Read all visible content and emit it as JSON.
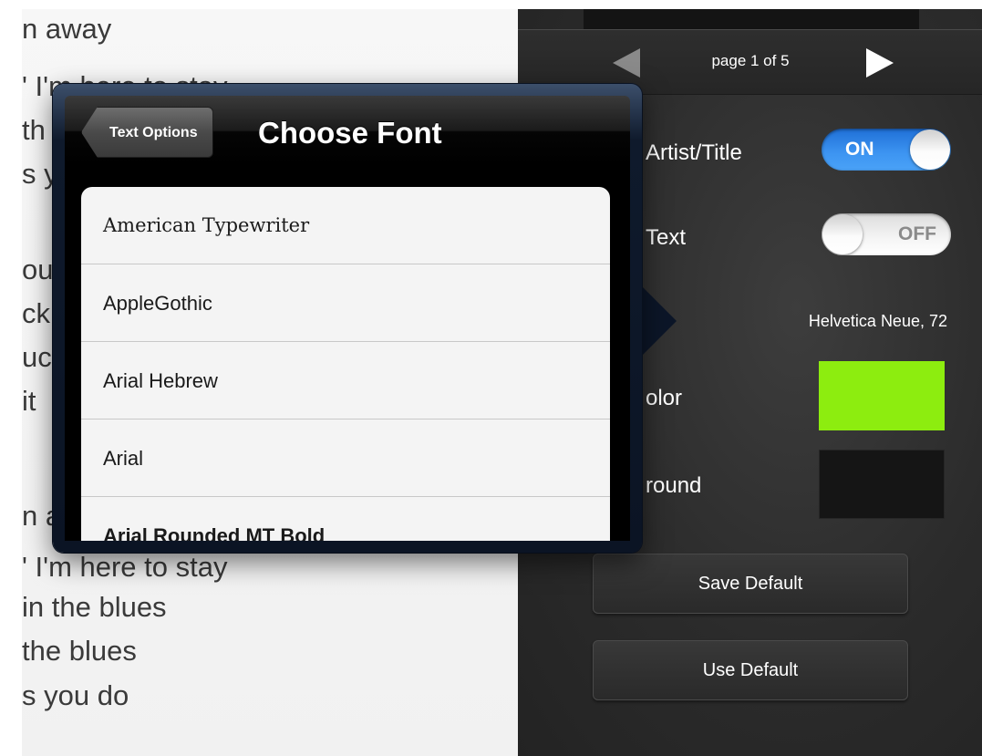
{
  "lyrics": {
    "lines": [
      "n away",
      "' I'm here to stay",
      "th",
      "s y",
      "",
      "out",
      "ck",
      "uc",
      " it",
      "",
      "n a",
      "' I'm here to stay",
      " in the blues",
      "the blues",
      "s you do"
    ]
  },
  "pager": {
    "label": "page 1 of 5"
  },
  "settings": {
    "artist_title_label": "Artist/Title",
    "artist_title_switch": "ON",
    "text_label": "Text",
    "text_switch": "OFF",
    "font_value": "Helvetica Neue, 72",
    "color_label": "olor",
    "background_label": "round",
    "text_color": "#8ded0f",
    "background_color": "#151515",
    "save_default": "Save Default",
    "use_default": "Use Default"
  },
  "popover": {
    "back_label": "Text Options",
    "title": "Choose Font",
    "fonts": [
      "American Typewriter",
      "AppleGothic",
      "Arial Hebrew",
      "Arial",
      "Arial Rounded MT Bold"
    ]
  },
  "colors": {
    "switch_on": "#3d95f2",
    "popover_frame": "#0c1628"
  }
}
